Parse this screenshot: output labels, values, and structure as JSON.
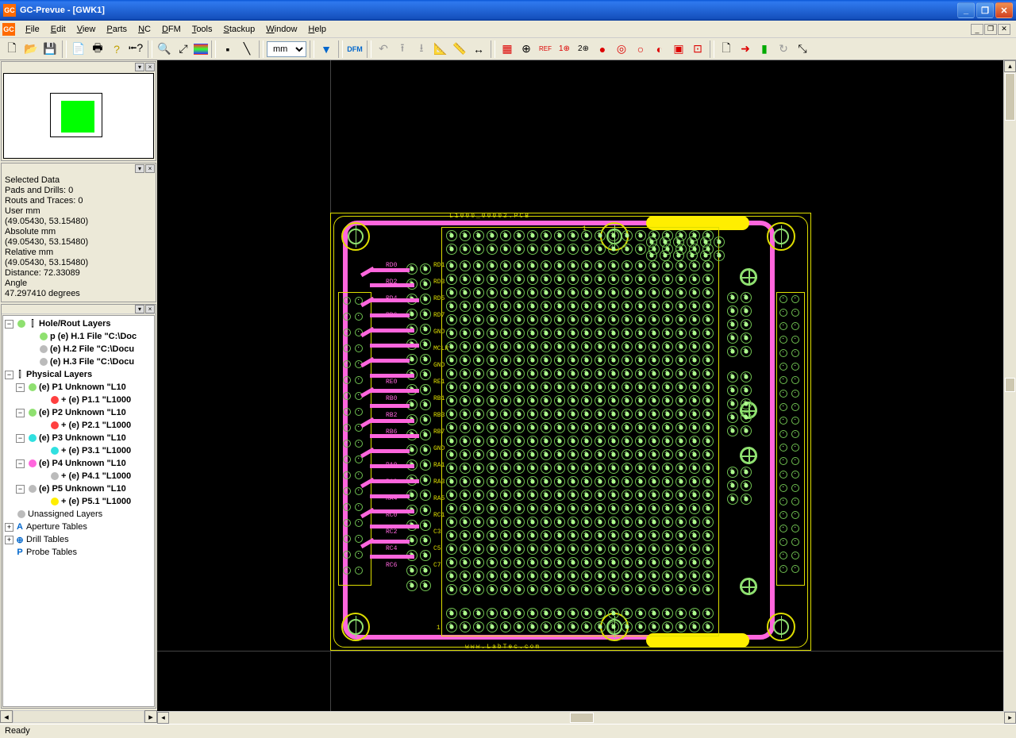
{
  "title": "GC-Prevue - [GWK1]",
  "app_icon": "GC",
  "menu": [
    "File",
    "Edit",
    "View",
    "Parts",
    "NC",
    "DFM",
    "Tools",
    "Stackup",
    "Window",
    "Help"
  ],
  "units_dropdown": "mm",
  "info": {
    "h1": "Selected Data",
    "l1": "Pads and Drills: 0",
    "l2": "Routs and Traces: 0",
    "l3": "User mm",
    "l4": "(49.05430, 53.15480)",
    "l5": "Absolute mm",
    "l6": "(49.05430, 53.15480)",
    "l7": "Relative mm",
    "l8": "(49.05430, 53.15480)",
    "l9": "Distance: 72.33089",
    "l10": "Angle",
    "l11": "47.297410 degrees"
  },
  "tree": {
    "g1": "Hole/Rout Layers",
    "h1": "p (e) H.1 File \"C:\\Doc",
    "h2": "(e) H.2 File \"C:\\Docu",
    "h3": "(e) H.3 File \"C:\\Docu",
    "g2": "Physical Layers",
    "p1": "(e) P1 Unknown \"L10",
    "p11": "+ (e) P1.1 \"L1000",
    "p2": "(e) P2 Unknown \"L10",
    "p21": "+ (e) P2.1 \"L1000",
    "p3": "(e) P3 Unknown \"L10",
    "p31": "+ (e) P3.1 \"L1000",
    "p4": "(e) P4 Unknown \"L10",
    "p41": "+ (e) P4.1 \"L1000",
    "p5": "(e) P5 Unknown \"L10",
    "p51": "+ (e) P5.1 \"L1000",
    "ul": "Unassigned Layers",
    "at": "Aperture Tables",
    "dt": "Drill Tables",
    "pt": "Probe Tables"
  },
  "colors": {
    "h": "#8fe070",
    "hg": "#bbb",
    "p1": "#8fe070",
    "p1s": "#ff4040",
    "p2": "#8fe070",
    "p2s": "#ff4040",
    "p3": "#30e0e0",
    "p3s": "#30e0e0",
    "p4": "#ff66dd",
    "p4s": "#bbb",
    "p5": "#bbb",
    "p5s": "#ffee00",
    "ul": "#bbb"
  },
  "status": "Ready",
  "pcb_labels": [
    "RD1",
    "RD3",
    "RD5",
    "RD7",
    "GND",
    "MCLR",
    "GND",
    "RE1",
    "RB1",
    "RB3",
    "RB7",
    "GND",
    "RA1",
    "RA3",
    "RA5",
    "RC1",
    "C3",
    "C5",
    "C7"
  ],
  "pcb_labels_left": [
    "RD0",
    "RD2",
    "RD4",
    "RD6",
    "",
    "",
    "",
    "RE0",
    "RB0",
    "RB2",
    "RB6",
    "",
    "RA0",
    "RA2",
    "RA4",
    "RC0",
    "RC2",
    "RC4",
    "RC6"
  ],
  "board_top_text": "L1000_00002.PCB",
  "board_bottom_text": "www.LabTec.com",
  "pin1": "1"
}
